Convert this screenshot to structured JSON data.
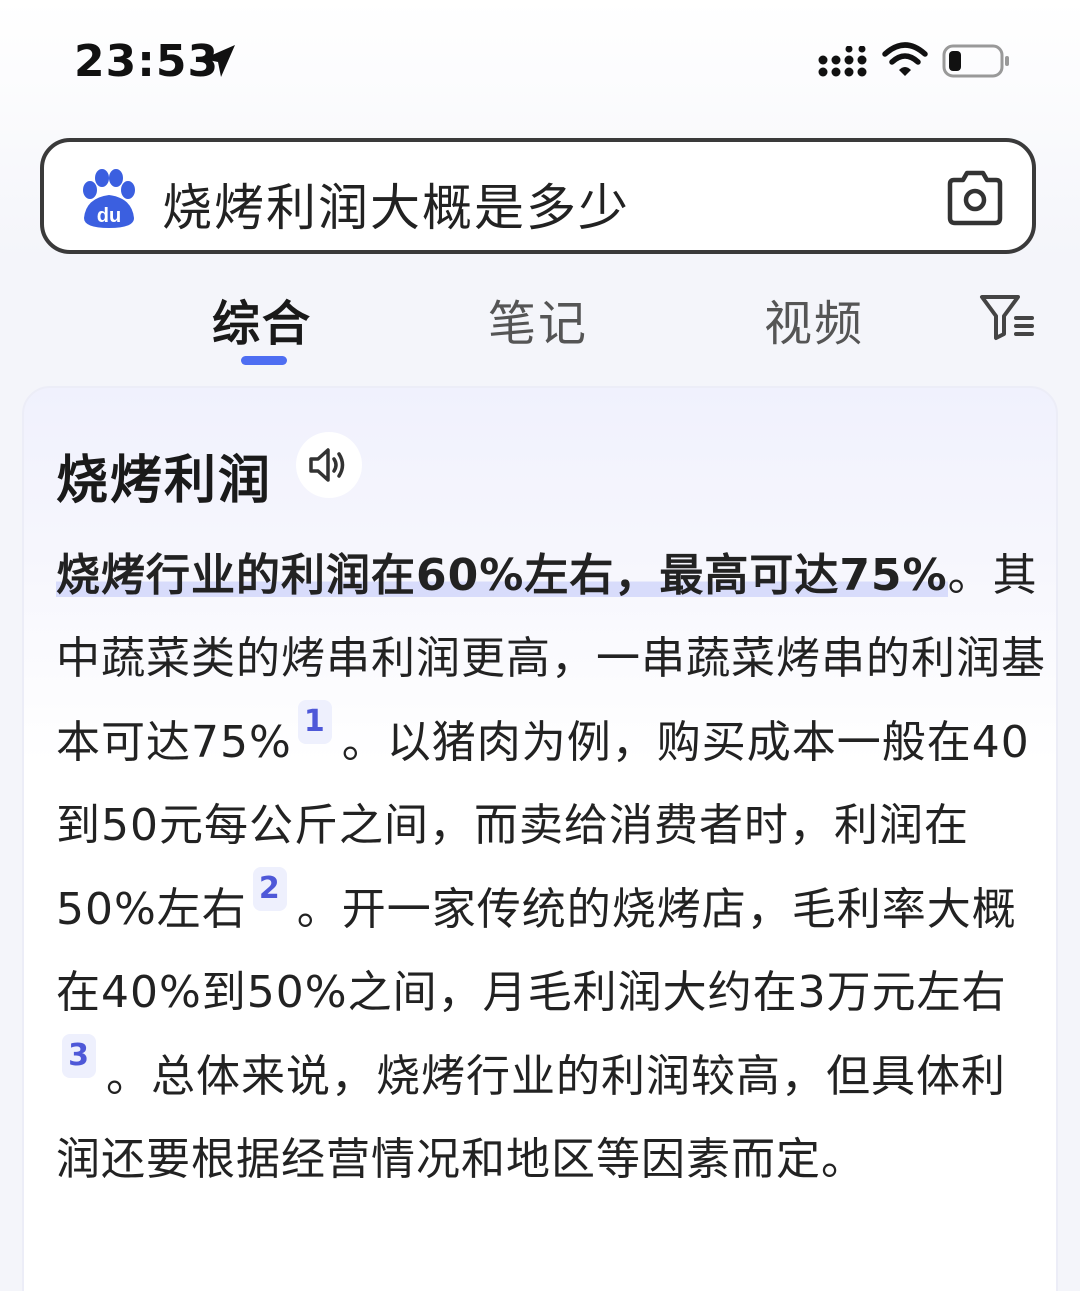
{
  "status_bar": {
    "time": "23:53"
  },
  "search": {
    "query": "烧烤利润大概是多少"
  },
  "tabs": [
    {
      "label": "综合",
      "active": true
    },
    {
      "label": "笔记",
      "active": false
    },
    {
      "label": "视频",
      "active": false
    }
  ],
  "answer_card": {
    "title": "烧烤利润",
    "highlight": "烧烤行业的利润在60%左右，最高可达75%",
    "seg1": "。其中蔬菜类的烤串利润更高，一串蔬菜烤串的利润基本可达75%",
    "cite1": "1",
    "seg2": "。以猪肉为例，购买成本一般在40到50元每公斤之间，而卖给消费者时，利润在50%左右",
    "cite2": "2",
    "seg3": "。开一家传统的烧烤店，毛利率大概在40%到50%之间，月毛利润大约在3万元左右",
    "cite3": "3",
    "seg4": "。总体来说，烧烤行业的利润较高，但具体利润还要根据经营情况和地区等因素而定。"
  },
  "colors": {
    "accent": "#4e6ef2",
    "highlight": "#d8dcfb",
    "citation": "#4e58d8"
  },
  "icons": [
    "location-arrow-icon",
    "signal-icon",
    "wifi-icon",
    "battery-icon",
    "baidu-paw-icon",
    "camera-icon",
    "filter-icon",
    "speaker-icon"
  ]
}
